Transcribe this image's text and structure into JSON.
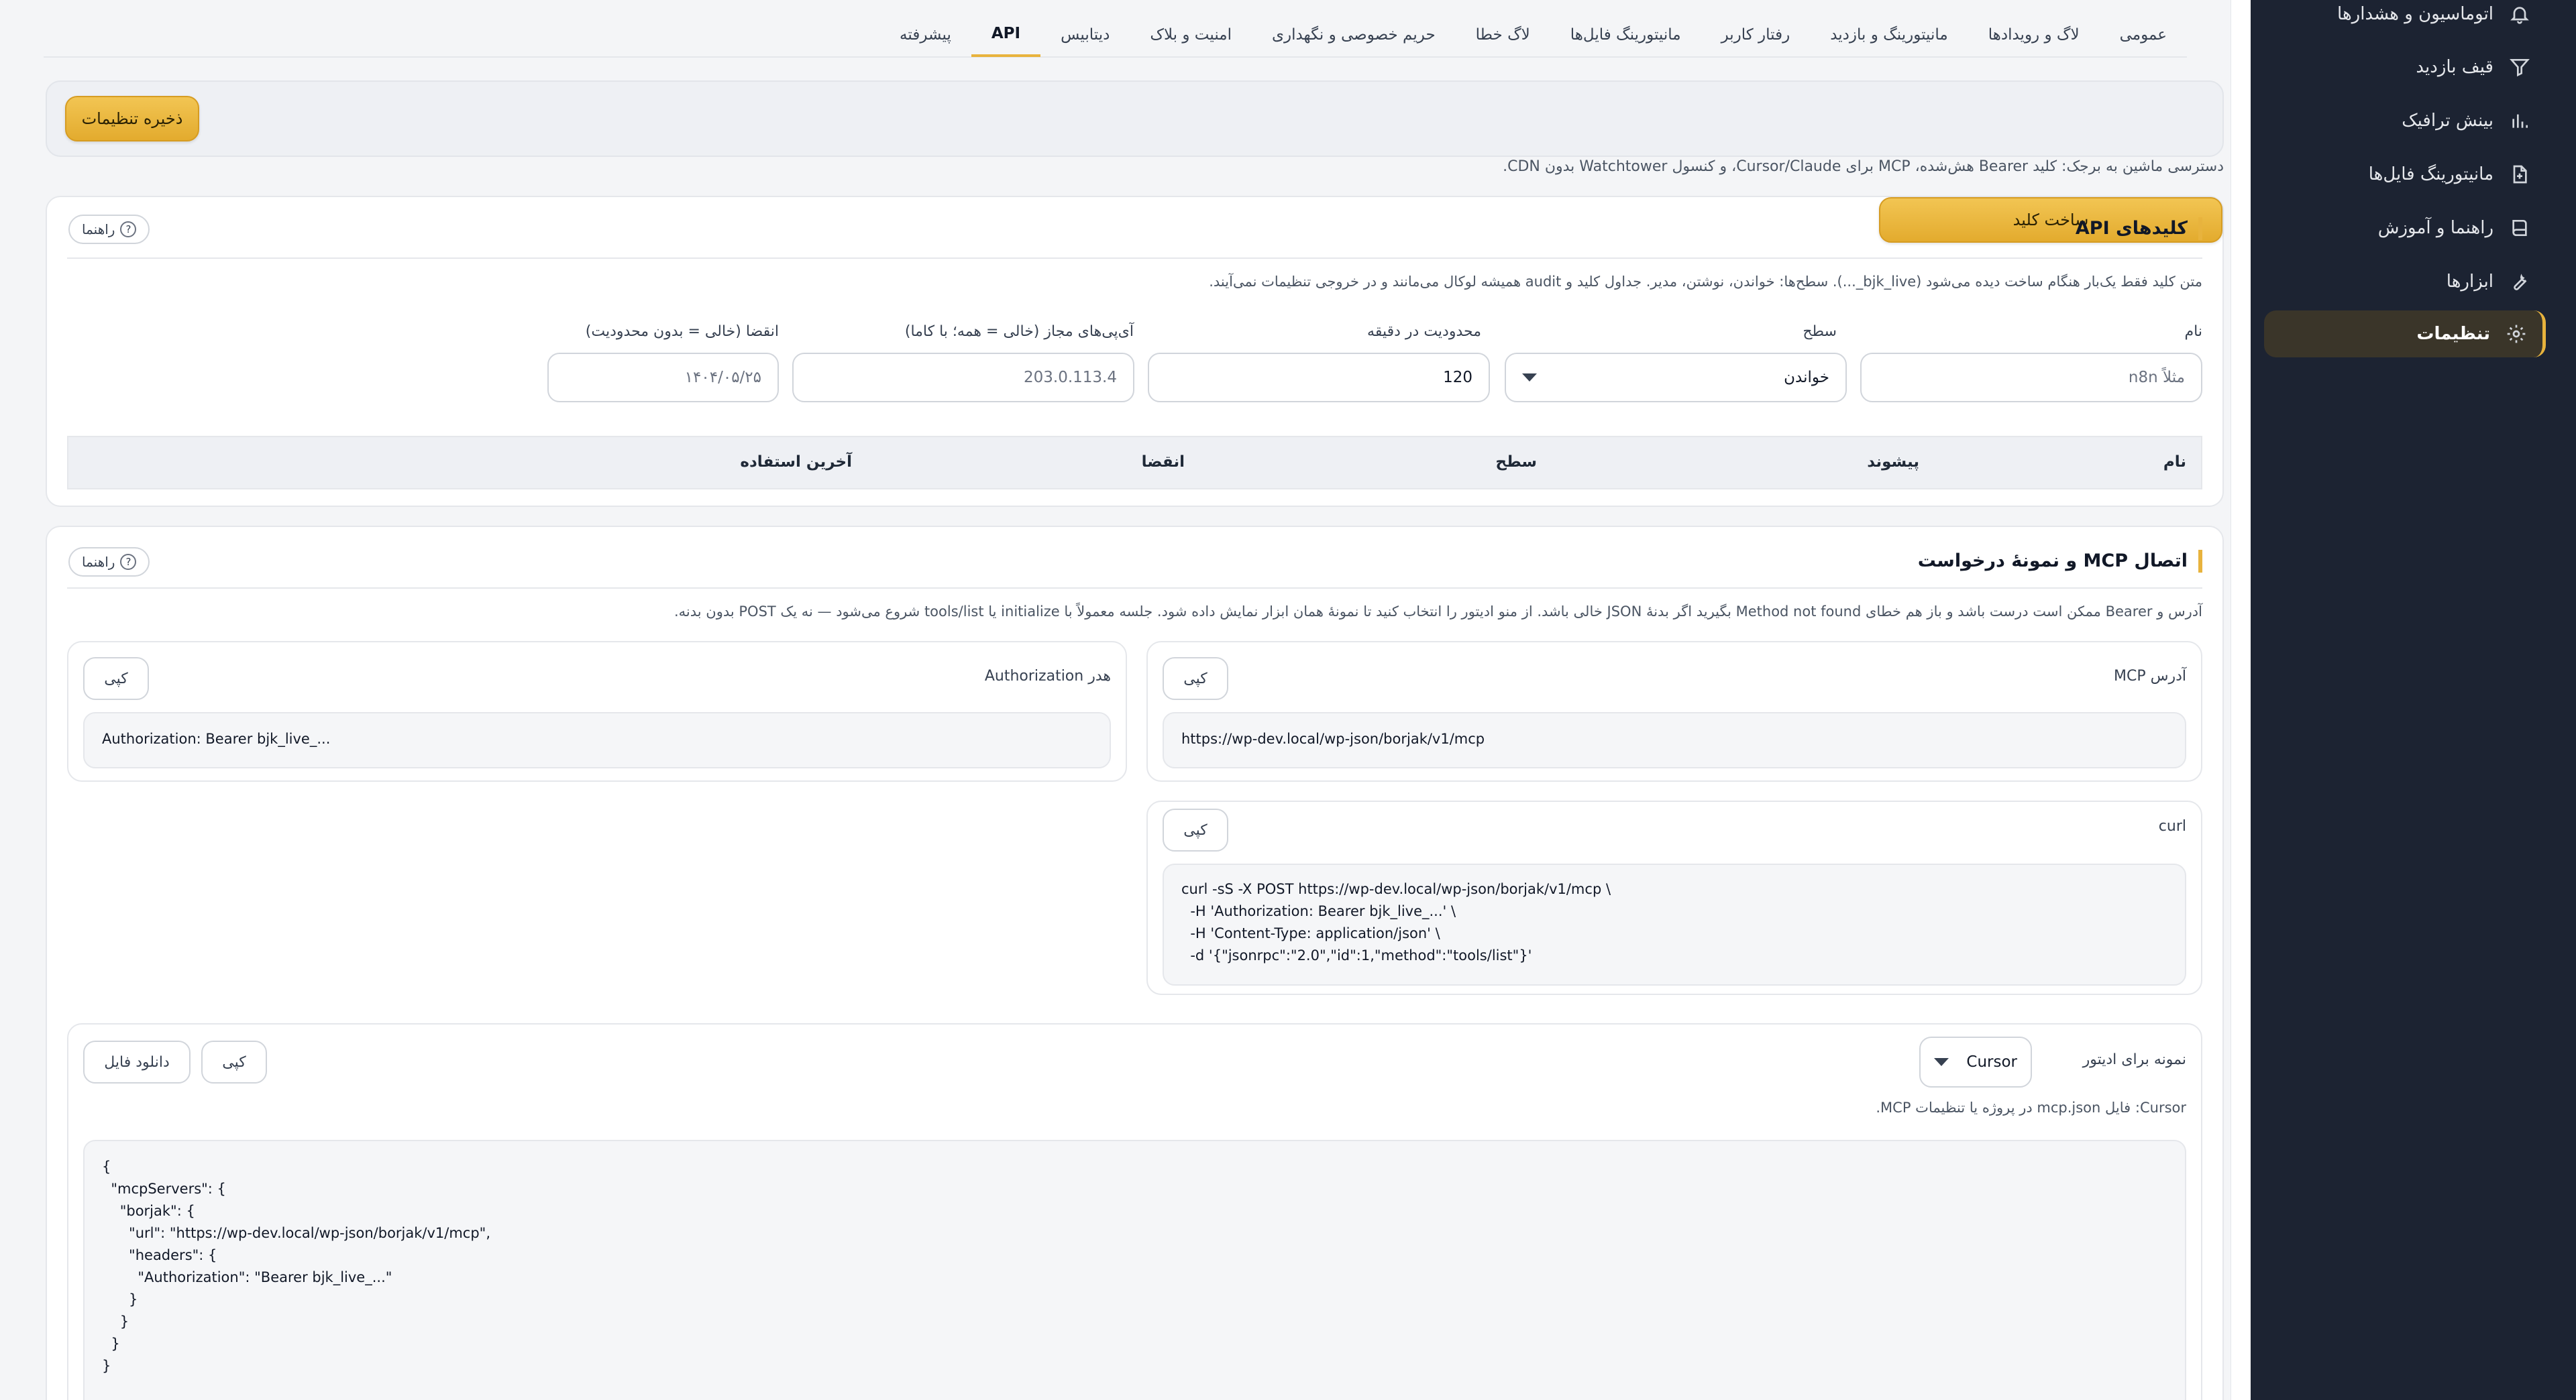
{
  "sidebar": {
    "items": [
      {
        "label": "اتوماسیون و هشدارها",
        "icon": "bell-icon"
      },
      {
        "label": "قیف بازدید",
        "icon": "filter-icon"
      },
      {
        "label": "بینش ترافیک",
        "icon": "bar-chart-icon"
      },
      {
        "label": "مانیتورینگ فایل‌ها",
        "icon": "file-icon"
      },
      {
        "label": "راهنما و آموزش",
        "icon": "book-icon"
      },
      {
        "label": "ابزارها",
        "icon": "wrench-icon"
      },
      {
        "label": "تنظیمات",
        "icon": "gear-icon"
      }
    ],
    "active_index": 6
  },
  "tabs": [
    "عمومی",
    "لاگ و رویدادها",
    "مانیتورینگ و بازدید",
    "رفتار کاربر",
    "مانیتورینگ فایل‌ها",
    "لاگ خطا",
    "حریم خصوصی و نگهداری",
    "امنیت و بلاک",
    "دیتابیس",
    "API",
    "پیشرفته"
  ],
  "active_tab": "API",
  "save_label": "ذخیره تنظیمات",
  "intro": "دسترسی ماشین به برجک: کلید Bearer هش‌شده، MCP برای Cursor/Claude، و کنسول Watchtower بدون CDN.",
  "guide_label": "راهنما",
  "api_keys": {
    "title": "کلیدهای API",
    "note": "متن کلید فقط یک‌بار هنگام ساخت دیده می‌شود (bjk_live_...). سطح‌ها: خواندن، نوشتن، مدیر. جداول کلید و audit همیشه لوکال می‌مانند و در خروجی تنظیمات نمی‌آیند.",
    "name_label": "نام",
    "name_placeholder": "مثلاً n8n",
    "level_label": "سطح",
    "level_value": "خواندن",
    "rate_label": "محدودیت در دقیقه",
    "rate_value": "120",
    "ips_label": "آی‌پی‌های مجاز (خالی = همه؛ با کاما)",
    "ips_placeholder": "203.0.113.4",
    "expiry_label": "انقضا (خالی = بدون محدودیت)",
    "expiry_placeholder": "۱۴۰۴/۰۵/۲۵",
    "create_label": "ساخت کلید",
    "columns": [
      "نام",
      "پیشوند",
      "سطح",
      "انقضا",
      "آخرین استفاده"
    ]
  },
  "mcp": {
    "title": "اتصال MCP و نمونهٔ درخواست",
    "note": "آدرس و Bearer ممکن است درست باشد و باز هم خطای Method not found بگیرید اگر بدنهٔ JSON خالی باشد. از منو ادیتور را انتخاب کنید تا نمونهٔ همان ابزار نمایش داده شود. جلسه معمولاً با initialize یا tools/list شروع می‌شود — نه یک POST بدون بدنه.",
    "address_label": "آدرس MCP",
    "address_value": "https://wp-dev.local/wp-json/borjak/v1/mcp",
    "auth_label": "هدر Authorization",
    "auth_value": "Authorization: Bearer bjk_live_...",
    "curl_label": "curl",
    "curl_value": "curl -sS -X POST https://wp-dev.local/wp-json/borjak/v1/mcp \\\n  -H 'Authorization: Bearer bjk_live_...' \\\n  -H 'Content-Type: application/json' \\\n  -d '{\"jsonrpc\":\"2.0\",\"id\":1,\"method\":\"tools/list\"}'",
    "copy_label": "کپی",
    "editor_label": "نمونه برای ادیتور",
    "editor_value": "Cursor",
    "download_label": "دانلود فایل",
    "editor_note": "Cursor: فایل mcp.json در پروژه یا تنظیمات MCP.",
    "json_value": "{\n  \"mcpServers\": {\n    \"borjak\": {\n      \"url\": \"https://wp-dev.local/wp-json/borjak/v1/mcp\",\n      \"headers\": {\n        \"Authorization\": \"Bearer bjk_live_...\"\n      }\n    }\n  }\n}"
  }
}
